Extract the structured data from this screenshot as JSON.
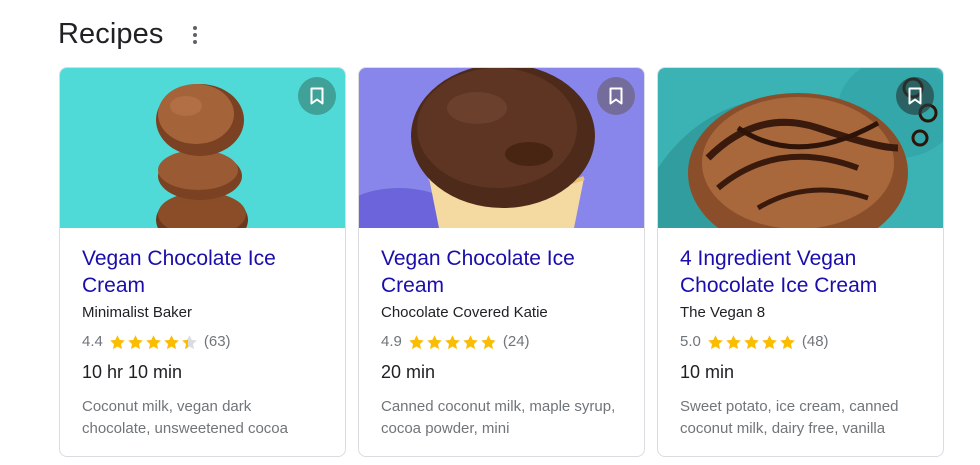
{
  "header": {
    "title": "Recipes",
    "more_icon": "more-vert-icon"
  },
  "colors": {
    "link": "#1a0dab",
    "star": "#fbbc04",
    "muted": "#70757a"
  },
  "cards": [
    {
      "title": "Vegan Chocolate Ice Cream",
      "source": "Minimalist Baker",
      "rating": "4.4",
      "rating_value": 4.4,
      "reviews": "(63)",
      "time": "10 hr 10 min",
      "ingredients": "Coconut milk, vegan dark chocolate, unsweetened cocoa",
      "bookmark_icon": "bookmark-icon"
    },
    {
      "title": "Vegan Chocolate Ice Cream",
      "source": "Chocolate Covered Katie",
      "rating": "4.9",
      "rating_value": 4.9,
      "reviews": "(24)",
      "time": "20 min",
      "ingredients": "Canned coconut milk, maple syrup, cocoa powder, mini",
      "bookmark_icon": "bookmark-icon"
    },
    {
      "title": "4 Ingredient Vegan Chocolate Ice Cream",
      "source": "The Vegan 8",
      "rating": "5.0",
      "rating_value": 5.0,
      "reviews": "(48)",
      "time": "10 min",
      "ingredients": "Sweet potato, ice cream, canned coconut milk, dairy free, vanilla",
      "bookmark_icon": "bookmark-icon"
    }
  ]
}
